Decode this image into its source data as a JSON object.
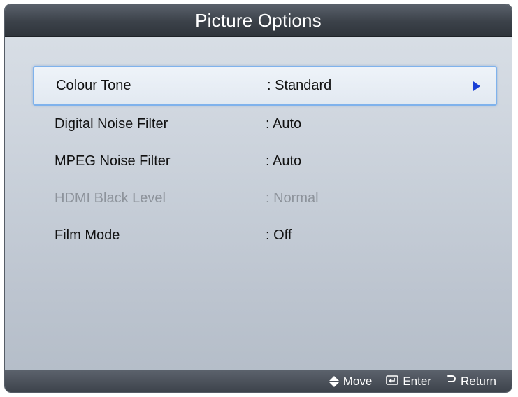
{
  "title": "Picture Options",
  "menu": {
    "items": [
      {
        "label": "Colour Tone",
        "value": ": Standard"
      },
      {
        "label": "Digital Noise Filter",
        "value": ": Auto"
      },
      {
        "label": "MPEG Noise Filter",
        "value": ": Auto"
      },
      {
        "label": "HDMI Black Level",
        "value": ": Normal"
      },
      {
        "label": "Film Mode",
        "value": ": Off"
      }
    ]
  },
  "footer": {
    "move_label": "Move",
    "enter_label": "Enter",
    "return_label": "Return",
    "move_icon": "up-down-arrows-icon",
    "enter_icon": "enter-icon",
    "return_icon": "return-icon"
  },
  "colors": {
    "title_bar": "#3b4149",
    "selection_border": "#7fb2ec",
    "arrow": "#1a3fd6",
    "disabled_text": "#8d939b"
  }
}
